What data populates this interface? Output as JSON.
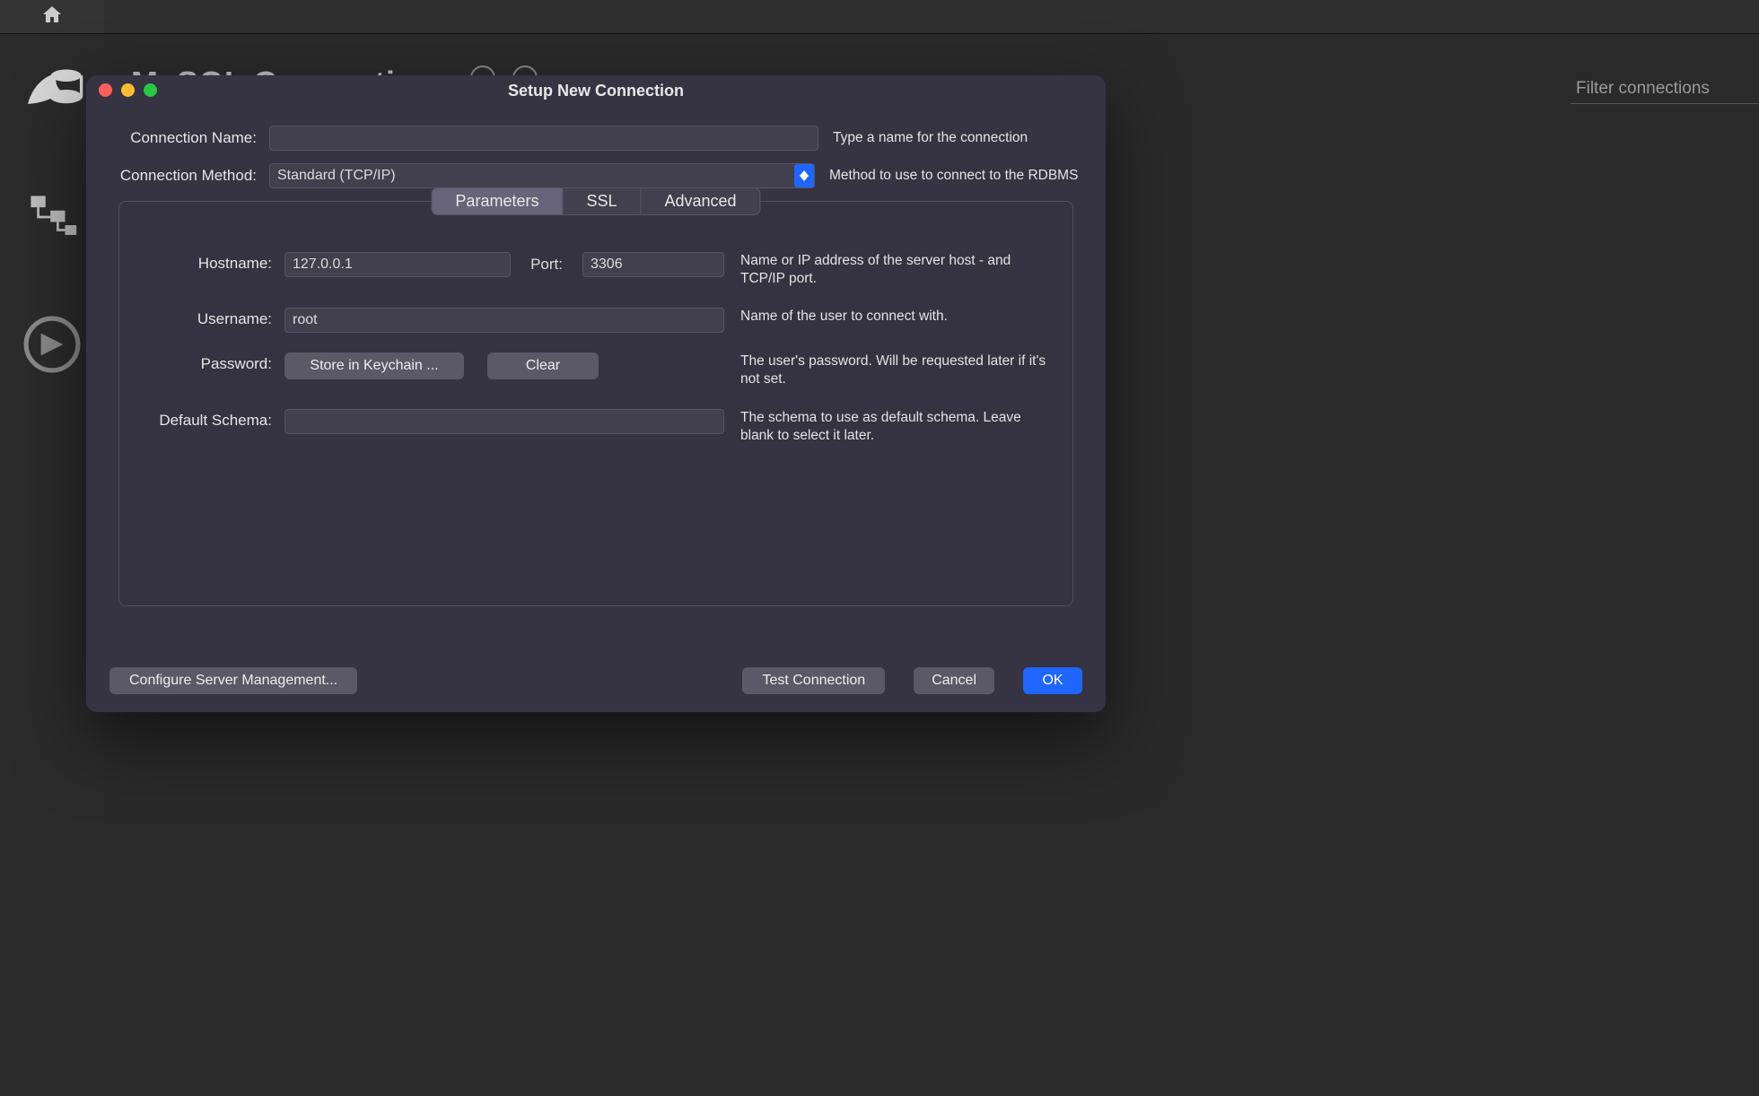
{
  "background": {
    "main_title": "MySQL Connections",
    "filter_placeholder": "Filter connections"
  },
  "dialog": {
    "title": "Setup New Connection",
    "connection_name": {
      "label": "Connection Name:",
      "value": "",
      "hint": "Type a name for the connection"
    },
    "connection_method": {
      "label": "Connection Method:",
      "value": "Standard (TCP/IP)",
      "hint": "Method to use to connect to the RDBMS"
    },
    "tabs": {
      "parameters": "Parameters",
      "ssl": "SSL",
      "advanced": "Advanced",
      "active": "parameters"
    },
    "hostname": {
      "label": "Hostname:",
      "value": "127.0.0.1",
      "port_label": "Port:",
      "port_value": "3306",
      "hint": "Name or IP address of the server host - and TCP/IP port."
    },
    "username": {
      "label": "Username:",
      "value": "root",
      "hint": "Name of the user to connect with."
    },
    "password": {
      "label": "Password:",
      "store_button": "Store in Keychain ...",
      "clear_button": "Clear",
      "hint": "The user's password. Will be requested later if it's not set."
    },
    "default_schema": {
      "label": "Default Schema:",
      "value": "",
      "hint": "The schema to use as default schema. Leave blank to select it later."
    },
    "footer": {
      "configure": "Configure Server Management...",
      "test": "Test Connection",
      "cancel": "Cancel",
      "ok": "OK"
    }
  }
}
